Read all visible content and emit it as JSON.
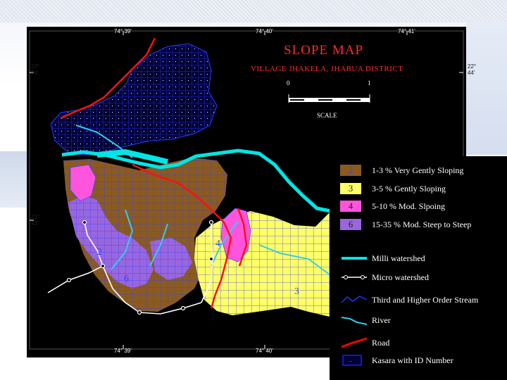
{
  "map": {
    "title": "SLOPE  MAP",
    "subtitle": "VILLAGE JHAKELA, JHABUA DISTRICT",
    "scale": {
      "start": "0",
      "end": "1",
      "label": "SCALE"
    },
    "top_ticks": [
      "74° 39'",
      "74° 40'",
      "74° 41'"
    ],
    "bottom_ticks": [
      "74° 39'",
      "74° 40'"
    ],
    "left_ticks": [
      [
        "22°",
        "44'"
      ],
      [
        "22°",
        "43'"
      ]
    ],
    "right_ticks": [
      [
        "22°",
        "44'"
      ]
    ]
  },
  "legend": {
    "slope_classes": [
      {
        "id": "2",
        "label": "1-3 % Very Gently Sloping",
        "color": "#8B5A1E"
      },
      {
        "id": "3",
        "label": "3-5 % Gently Sloping",
        "color": "#FFFF66"
      },
      {
        "id": "4",
        "label": "5-10 % Mod. Slpoing",
        "color": "#FF55DD"
      },
      {
        "id": "6",
        "label": "15-35 % Mod. Steep to Steep",
        "color": "#9966DD"
      }
    ],
    "line_features": [
      {
        "label": "Milli watershed",
        "color": "#00E5E5",
        "icon": "milli-watershed-line-icon"
      },
      {
        "label": "Micro watershed",
        "color": "#FFFFFF",
        "icon": "micro-watershed-line-icon"
      },
      {
        "label": "Third and Higher Order Stream",
        "color": "#2233FF",
        "icon": "stream-line-icon"
      },
      {
        "label": "River",
        "color": "#33CCEE",
        "icon": "river-line-icon"
      },
      {
        "label": "Road",
        "color": "#FF0000",
        "icon": "road-line-icon"
      },
      {
        "label": "Kasara with ID Number",
        "color": "#1122FF",
        "icon": "kasara-box-icon"
      }
    ]
  },
  "zone_labels": {
    "brown": "2",
    "purple": "6",
    "yellow": "3",
    "pink": "4"
  }
}
